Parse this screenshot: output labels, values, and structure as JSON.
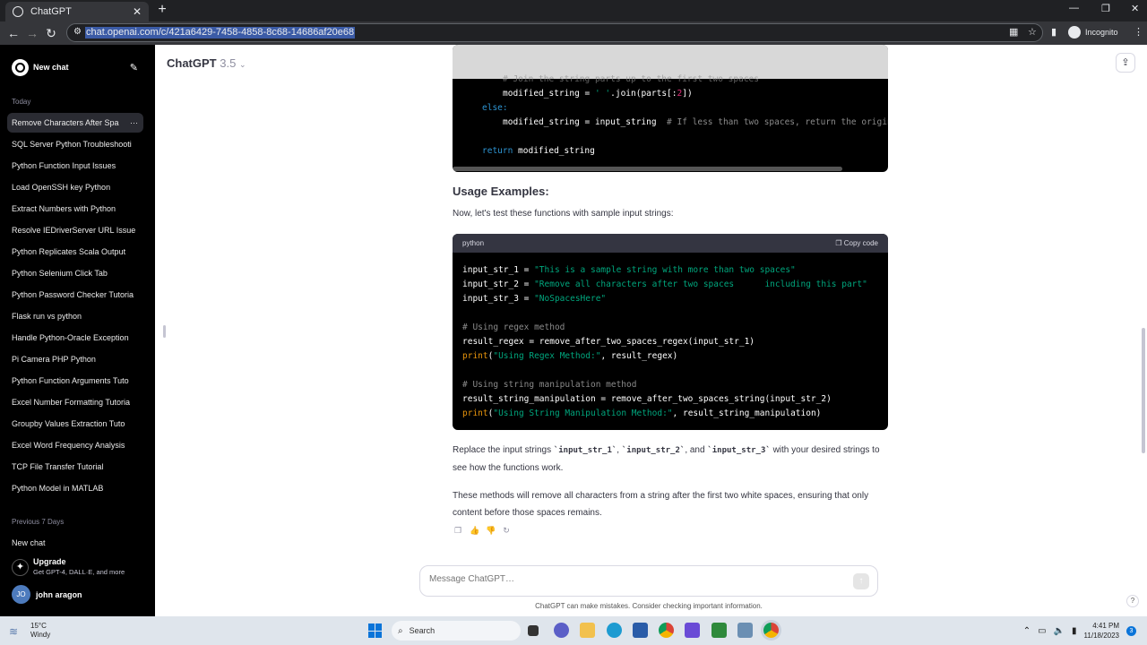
{
  "browser": {
    "tab_title": "ChatGPT",
    "url": "chat.openai.com/c/421a6429-7458-4858-8c68-14686af20e68",
    "incognito_label": "Incognito"
  },
  "sidebar": {
    "new_chat_label": "New chat",
    "group_today": "Today",
    "items_today": [
      "Remove Characters After Spa",
      "SQL Server Python Troubleshooti",
      "Python Function Input Issues",
      "Load OpenSSH key Python",
      "Extract Numbers with Python",
      "Resolve IEDriverServer URL Issue",
      "Python Replicates Scala Output",
      "Python Selenium Click Tab",
      "Python Password Checker Tutoria",
      "Flask run vs python",
      "Handle Python-Oracle Exception",
      "Pi Camera PHP Python",
      "Python Function Arguments Tuto",
      "Excel Number Formatting Tutoria",
      "Groupby Values Extraction Tuto",
      "Excel Word Frequency Analysis",
      "TCP File Transfer Tutorial",
      "Python Model in MATLAB"
    ],
    "group_prev7": "Previous 7 Days",
    "items_prev7": [
      "New chat"
    ],
    "upgrade_title": "Upgrade",
    "upgrade_sub": "Get GPT-4, DALL·E, and more",
    "user_initials": "JO",
    "user_name": "john aragon"
  },
  "header": {
    "model_name": "ChatGPT",
    "model_version": "3.5"
  },
  "content": {
    "code_top_lines": [
      "# Join the string parts up to the first two spaces",
      "modified_string = ' '.join(parts[:2])",
      "else:",
      "modified_string = input_string  # If less than two spaces, return the origina",
      "return modified_string"
    ],
    "usage_heading": "Usage Examples:",
    "usage_intro": "Now, let's test these functions with sample input strings:",
    "code2_lang": "python",
    "code2_copy": "Copy code",
    "para_replace_a": "Replace the input strings ",
    "var1": "`input_str_1`",
    "sep1": ", ",
    "var2": "`input_str_2`",
    "sep2": ", and ",
    "var3": "`input_str_3`",
    "para_replace_b": " with your desired strings to see how the functions work.",
    "para_final": "These methods will remove all characters from a string after the first two white spaces, ensuring that only content before those spaces remains."
  },
  "composer": {
    "placeholder": "Message ChatGPT…",
    "disclaimer": "ChatGPT can make mistakes. Consider checking important information."
  },
  "taskbar": {
    "temp": "15°C",
    "condition": "Windy",
    "search_label": "Search",
    "time": "4:41 PM",
    "date": "11/18/2023",
    "notif_count": "3"
  }
}
